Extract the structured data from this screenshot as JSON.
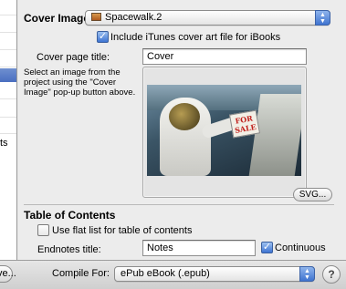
{
  "left_pane": {
    "partial_label": "ts",
    "partial_button": "ve..."
  },
  "cover": {
    "label": "Cover Image:",
    "selected": "Spacewalk.2",
    "include_itunes_label": "Include iTunes cover art file for iBooks",
    "include_itunes_checked": true,
    "page_title_label": "Cover page title:",
    "page_title_value": "Cover",
    "hint": "Select an image from the project using the \"Cover Image\" pop-up button above.",
    "svg_button": "SVG...",
    "sign_text_line1": "FOR",
    "sign_text_line2": "SALE"
  },
  "toc": {
    "heading": "Table of Contents",
    "flat_list_label": "Use flat list for table of contents",
    "flat_list_checked": false,
    "endnotes_label": "Endnotes title:",
    "endnotes_value": "Notes",
    "continuous_label": "Continuous",
    "continuous_checked": true
  },
  "bottom": {
    "compile_label": "Compile For:",
    "compile_value": "ePub eBook (.epub)",
    "help": "?"
  },
  "colors": {
    "accent": "#3f74d0",
    "selection": "#4a6fc0"
  },
  "icons": [
    "image-file-icon",
    "popup-arrows-icon",
    "checkmark-icon",
    "help-icon"
  ]
}
